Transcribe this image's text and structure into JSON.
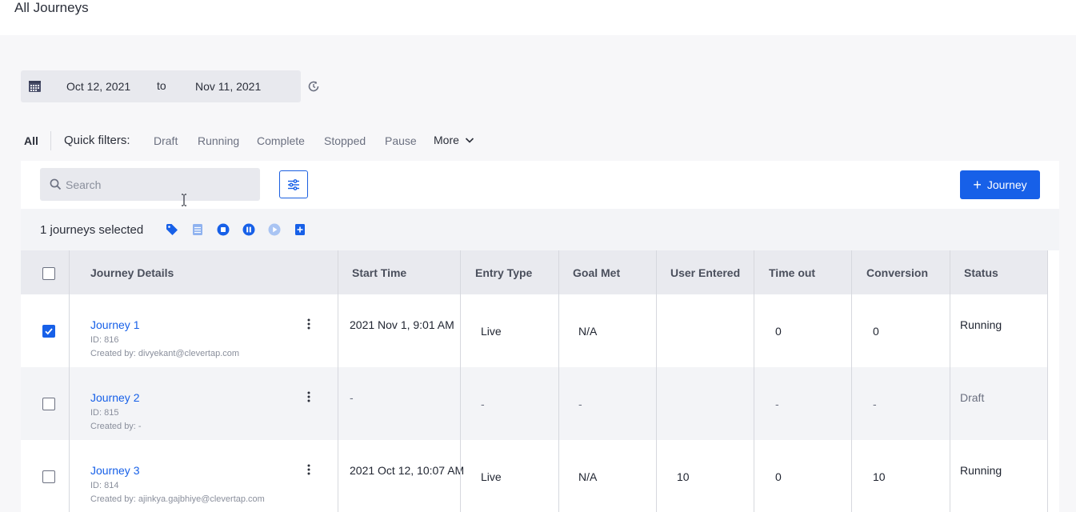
{
  "page": {
    "title": "All Journeys"
  },
  "date_range": {
    "from": "Oct 12, 2021",
    "separator": "to",
    "to": "Nov 11, 2021"
  },
  "filters": {
    "all": "All",
    "label": "Quick filters:",
    "items": [
      "Draft",
      "Running",
      "Complete",
      "Stopped",
      "Pause"
    ],
    "more": "More"
  },
  "search": {
    "placeholder": "Search",
    "value": ""
  },
  "actions": {
    "add_label": "Journey"
  },
  "selection": {
    "text": "1 journeys selected"
  },
  "colors": {
    "accent": "#1760e8",
    "header_bg": "#e9eaef"
  },
  "table": {
    "headers": [
      "Journey Details",
      "Start Time",
      "Entry Type",
      "Goal Met",
      "User Entered",
      "Time out",
      "Conversion",
      "Status"
    ],
    "rows": [
      {
        "checked": true,
        "name": "Journey 1",
        "id": "ID: 816",
        "created": "Created by: divyekant@clevertap.com",
        "start": "2021 Nov 1, 9:01 AM",
        "entry": "Live",
        "goal": "N/A",
        "users": "",
        "timeout": "0",
        "conversion": "0",
        "status": "Running"
      },
      {
        "checked": false,
        "name": "Journey 2",
        "id": "ID: 815",
        "created": "Created by: -",
        "start": "-",
        "entry": "-",
        "goal": "-",
        "users": "",
        "timeout": "-",
        "conversion": "-",
        "status": "Draft"
      },
      {
        "checked": false,
        "name": "Journey 3",
        "id": "ID: 814",
        "created": "Created by: ajinkya.gajbhiye@clevertap.com",
        "start": "2021 Oct 12, 10:07 AM",
        "entry": "Live",
        "goal": "N/A",
        "users": "10",
        "timeout": "0",
        "conversion": "10",
        "status": "Running"
      }
    ]
  }
}
